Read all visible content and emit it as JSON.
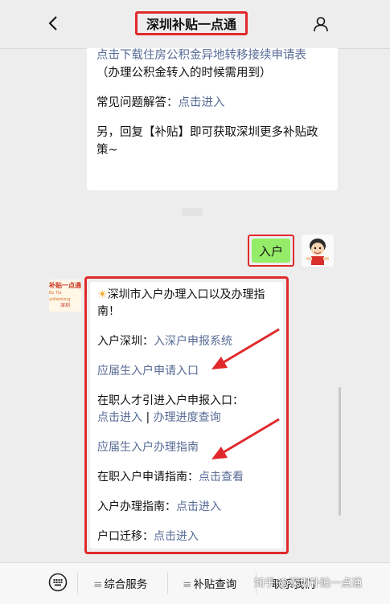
{
  "header": {
    "title": "深圳补贴一点通",
    "back_icon": "chevron-left-icon",
    "profile_icon": "user-icon"
  },
  "top_bubble": {
    "link1": "点击下载住房公积金异地转移接续申请表",
    "text1": "（办理公积金转入的时候需用到）",
    "faq_label": "常见问题解答：",
    "faq_link": "点击进入",
    "note": "另，回复【补贴】即可获取深圳更多补贴政策~"
  },
  "sent_message": "入户",
  "reply": {
    "heading": "深圳市入户办理入口以及办理指南！",
    "heading_icon": "sun-emoji-icon",
    "line1_label": "入户深圳：",
    "line1_link": "入深户申报系统",
    "line2_link": "应届生入户申请入口",
    "line3_label": "在职人才引进入户申报入口：",
    "line4_link_a": "点击进入",
    "line4_sep": " | ",
    "line4_link_b": "办理进度查询",
    "line5_link": "应届生入户办理指南",
    "line6_label": "在职入户申请指南：",
    "line6_link": "点击查看",
    "line7_label": "入户办理指南：",
    "line7_link": "点击进入",
    "line8_label": "户口迁移：",
    "line8_link": "点击进入"
  },
  "avatar_brand": {
    "line1": "补贴一点通",
    "line2": "Bu Tie yidiantong",
    "line3": "深圳"
  },
  "bottom_menu": {
    "keyboard_icon": "keyboard-icon",
    "item1": "综合服务",
    "item2": "补贴查询",
    "item3": "联系我们",
    "watermark": "知乎 @深圳补贴一点通"
  },
  "colors": {
    "link": "#576b95",
    "highlight_red": "#e0292b",
    "sent_bubble": "#95ec69",
    "background": "#ededed"
  }
}
